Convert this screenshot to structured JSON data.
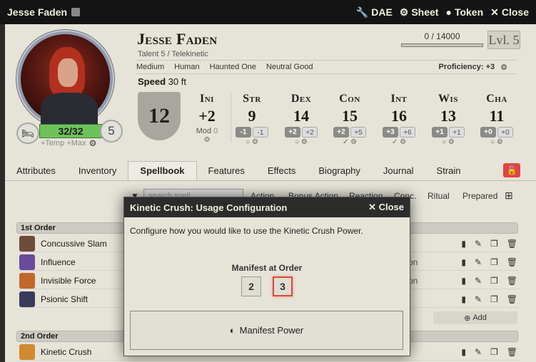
{
  "window": {
    "title": "Jesse Faden",
    "controls": [
      {
        "icon": "wrench-icon",
        "label": "DAE"
      },
      {
        "icon": "gear-icon",
        "label": "Sheet"
      },
      {
        "icon": "user-circle-icon",
        "label": "Token"
      },
      {
        "icon": "close-icon",
        "label": "Close"
      }
    ]
  },
  "character": {
    "name": "Jesse Faden",
    "subtitle": "Talent 5 / Telekinetic",
    "xp": "0 / 14000",
    "level": "Lvl. 5",
    "details": [
      "Medium",
      "Human",
      "Haunted One",
      "Neutral Good"
    ],
    "proficiency": "Proficiency: +3",
    "speed_label": "Speed",
    "speed_value": "30 ft",
    "hp": "32/32",
    "hit_dice": "5",
    "hp_sub": "+Temp +Max",
    "ac": "12"
  },
  "initiative": {
    "label": "Ini",
    "value": "+2",
    "mod_label": "Mod",
    "mod_value": "0"
  },
  "abilities": [
    {
      "label": "Str",
      "value": "9",
      "mod": "-1",
      "save": "-1"
    },
    {
      "label": "Dex",
      "value": "14",
      "mod": "+2",
      "save": "+2"
    },
    {
      "label": "Con",
      "value": "15",
      "mod": "+2",
      "save": "+5"
    },
    {
      "label": "Int",
      "value": "16",
      "mod": "+3",
      "save": "+6"
    },
    {
      "label": "Wis",
      "value": "13",
      "mod": "+1",
      "save": "+1"
    },
    {
      "label": "Cha",
      "value": "11",
      "mod": "+0",
      "save": "+0"
    }
  ],
  "tabs": [
    "Attributes",
    "Inventory",
    "Spellbook",
    "Features",
    "Effects",
    "Biography",
    "Journal",
    "Strain"
  ],
  "spellbook": {
    "search_placeholder": "search spell...",
    "filters": [
      "Action",
      "Bonus Action",
      "Reaction",
      "Conc.",
      "Ritual",
      "Prepared"
    ],
    "sections": [
      {
        "label": "1st Order",
        "spells": [
          "Concussive Slam",
          "Influence",
          "Invisible Force",
          "Psionic Shift"
        ]
      },
      {
        "label": "2nd Order",
        "spells": [
          "Kinetic Crush"
        ]
      }
    ],
    "row_fragment": "on",
    "add_label": "Add"
  },
  "dialog": {
    "title": "Kinetic Crush: Usage Configuration",
    "close_label": "Close",
    "text": "Configure how you would like to use the Kinetic Crush Power.",
    "manifest_label": "Manifest at Order",
    "orders": [
      "2",
      "3"
    ],
    "selected_order": "3",
    "button_label": "Manifest Power"
  },
  "colors": {
    "hp": "#6ec25a",
    "lock": "#e04444",
    "selected": "#d84a3a"
  }
}
